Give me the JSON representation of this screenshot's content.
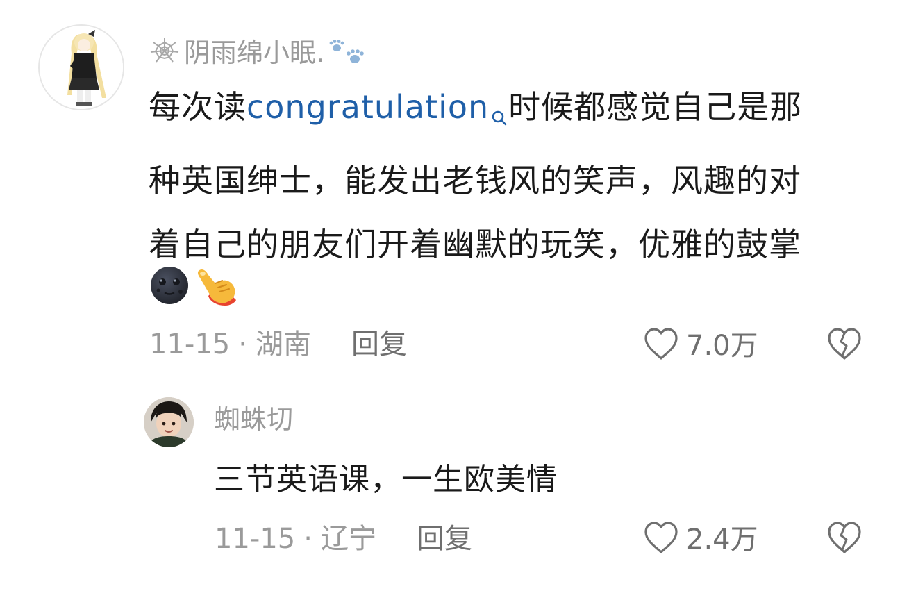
{
  "comment": {
    "username": "阴雨绵小眠.",
    "username_badge_icon": "paw-prints-icon",
    "username_prefix_icon": "spiderweb-icon",
    "text_lines": [
      "时候都感觉自己是那",
      "种英国绅士，能发出老钱风的笑声，风趣的对",
      "着自己的朋友们开着幽默的玩笑，优雅的鼓掌"
    ],
    "text_prefix": "每次读",
    "link_word": "congratulation",
    "emojis": [
      "new-moon-face-emoji",
      "pointing-hand-emoji"
    ],
    "date": "11-15",
    "separator": "·",
    "location": "湖南",
    "reply_label": "回复",
    "like_count": "7.0万"
  },
  "reply": {
    "username": "蜘蛛切",
    "text": "三节英语课，一生欧美情",
    "date": "11-15",
    "separator": "·",
    "location": "辽宁",
    "reply_label": "回复",
    "like_count": "2.4万"
  },
  "colors": {
    "text": "#1a1a1a",
    "meta": "#9a9a9a",
    "link": "#1f5fa8",
    "icon": "#6f6f6f"
  }
}
